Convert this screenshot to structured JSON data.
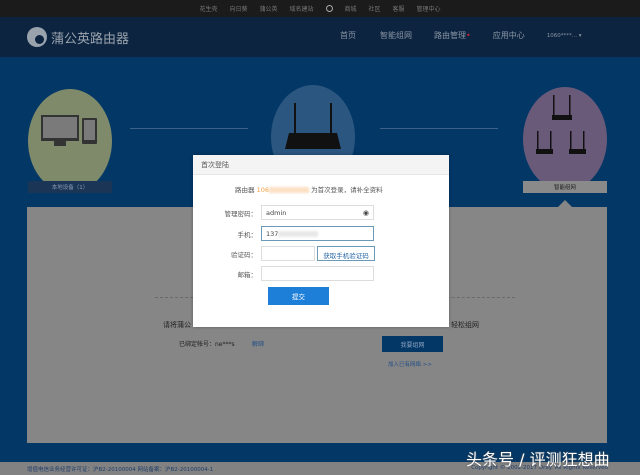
{
  "topbar": {
    "links": [
      "花生壳",
      "向日葵",
      "蒲公英",
      "域名建站",
      "商城",
      "社区",
      "客服",
      "管理中心"
    ]
  },
  "header": {
    "brand": "蒲公英路由器",
    "nav": [
      "首页",
      "智能组网",
      "路由管理",
      "应用中心"
    ],
    "user": "1060****..."
  },
  "steps": {
    "left_label": "本地设备（1）",
    "right_label": "智能组网"
  },
  "main": {
    "instruction_left": "请将蒲公",
    "instruction_right": "轻松组网",
    "bound_label": "已绑定帐号：ne***s",
    "unbind": "解绑",
    "network_button": "我要组网",
    "join_link": "加入已有网络 >>"
  },
  "modal": {
    "title": "首次登陆",
    "notice_prefix": "路由器",
    "notice_sn": "106",
    "notice_suffix": "为首次登录，请补全资料",
    "password_label": "管理密码：",
    "password_value": "admin",
    "phone_label": "手机：",
    "phone_value": "137",
    "code_label": "验证码：",
    "code_value": "",
    "get_code": "获取手机验证码",
    "email_label": "邮箱：",
    "email_value": "",
    "submit": "提交"
  },
  "footer": {
    "license": "增值电信业务经营许可证：沪B2-20100004 网站备案：沪B2-20100004-1",
    "copyright": "Copyright © 2002-2017 Oray. All Rights Reserved"
  },
  "watermark": "头条号 / 评测狂想曲",
  "colors": {
    "accent": "#1e7fd8",
    "header": "#0c2440",
    "main": "#023766"
  }
}
